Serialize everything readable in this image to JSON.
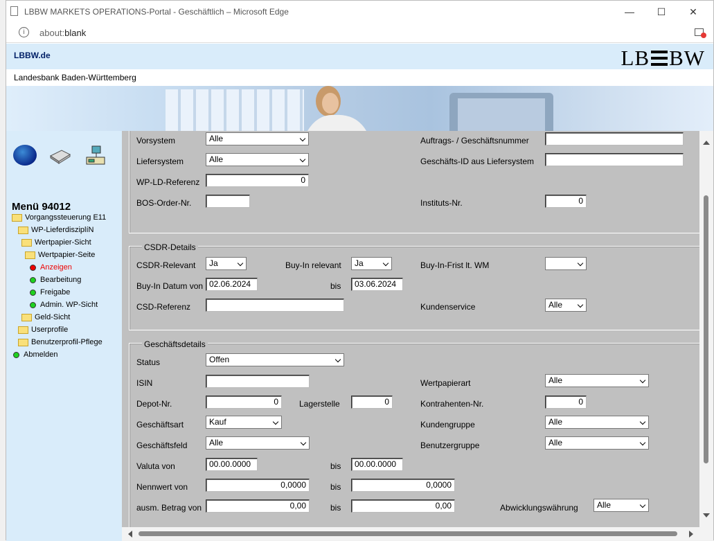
{
  "window": {
    "title": "LBBW MARKETS OPERATIONS-Portal - Geschäftlich – Microsoft Edge",
    "address_prefix": "about:",
    "address_main": "blank",
    "controls": {
      "minimize": "—",
      "maximize": "☐",
      "close": "✕"
    }
  },
  "header": {
    "link": "LBBW.de",
    "logo_left": "LB",
    "logo_right": "BW",
    "bank_name": "Landesbank Baden-Württemberg"
  },
  "sidebar": {
    "menu_title": "Menü 94012",
    "items": [
      {
        "label": "Vorgangssteuerung E11"
      },
      {
        "label": "WP-LieferdisziplíN"
      },
      {
        "label": "Wertpapier-Sicht"
      },
      {
        "label": "Wertpapier-Seite"
      },
      {
        "label": "Anzeigen"
      },
      {
        "label": "Bearbeitung"
      },
      {
        "label": "Freigabe"
      },
      {
        "label": "Admin. WP-Sicht"
      },
      {
        "label": "Geld-Sicht"
      },
      {
        "label": "Userprofile"
      },
      {
        "label": "Benutzerprofil-Pflege"
      },
      {
        "label": "Abmelden"
      }
    ]
  },
  "form": {
    "top": {
      "vorsystem_label": "Vorsystem",
      "vorsystem_value": "Alle",
      "auftrag_label": "Auftrags- / Geschäftsnummer",
      "auftrag_value": "",
      "liefersystem_label": "Liefersystem",
      "liefersystem_value": "Alle",
      "geschaeftsid_label": "Geschäfts-ID aus Liefersystem",
      "geschaeftsid_value": "",
      "wpld_label": "WP-LD-Referenz",
      "wpld_value": "0",
      "bos_label": "BOS-Order-Nr.",
      "bos_value": "",
      "instituts_label": "Instituts-Nr.",
      "instituts_value": "0"
    },
    "csdr": {
      "legend": "CSDR-Details",
      "relevant_label": "CSDR-Relevant",
      "relevant_value": "Ja",
      "buyin_rel_label": "Buy-In relevant",
      "buyin_rel_value": "Ja",
      "buyin_frist_label": "Buy-In-Frist lt. WM",
      "buyin_frist_value": "",
      "buyin_datum_label": "Buy-In Datum von",
      "buyin_von_value": "02.06.2024",
      "bis_label": "bis",
      "buyin_bis_value": "03.06.2024",
      "csd_ref_label": "CSD-Referenz",
      "csd_ref_value": "",
      "kundenservice_label": "Kundenservice",
      "kundenservice_value": "Alle"
    },
    "geschaeft": {
      "legend": "Geschäftsdetails",
      "status_label": "Status",
      "status_value": "Offen",
      "isin_label": "ISIN",
      "isin_value": "",
      "wpart_label": "Wertpapierart",
      "wpart_value": "Alle",
      "depot_label": "Depot-Nr.",
      "depot_value": "0",
      "lager_label": "Lagerstelle",
      "lager_value": "0",
      "kontra_label": "Kontrahenten-Nr.",
      "kontra_value": "0",
      "gart_label": "Geschäftsart",
      "gart_value": "Kauf",
      "kgruppe_label": "Kundengruppe",
      "kgruppe_value": "Alle",
      "gfeld_label": "Geschäftsfeld",
      "gfeld_value": "Alle",
      "bgruppe_label": "Benutzergruppe",
      "bgruppe_value": "Alle",
      "valuta_label": "Valuta von",
      "valuta_von": "00.00.0000",
      "valuta_bis": "00.00.0000",
      "nenn_label": "Nennwert von",
      "nenn_von": "0,0000",
      "nenn_bis": "0,0000",
      "betrag_label": "ausm. Betrag von",
      "betrag_von": "0,00",
      "betrag_bis": "0,00",
      "bis_label": "bis",
      "waehrung_label": "Abwicklungswährung",
      "waehrung_value": "Alle"
    }
  }
}
